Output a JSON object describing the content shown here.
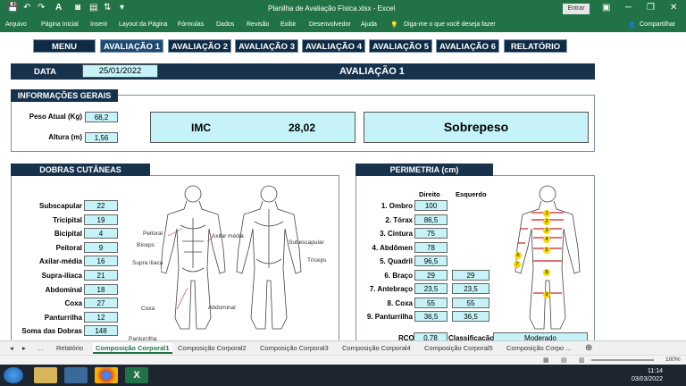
{
  "window": {
    "title": "Planilha de Avaliação Física.xlsx  -  Excel",
    "signin_label": "Entrar"
  },
  "ribbon": {
    "tabs": [
      "Arquivo",
      "Página Inicial",
      "Inserir",
      "Layout da Página",
      "Fórmulas",
      "Dados",
      "Revisão",
      "Exibir",
      "Desenvolvedor",
      "Ajuda"
    ],
    "tell_me": "Diga-me o que você deseja fazer",
    "share": "Compartilhar"
  },
  "nav": [
    "MENU",
    "AVALIAÇÃO 1",
    "AVALIAÇÃO 2",
    "AVALIAÇÃO 3",
    "AVALIAÇÃO 4",
    "AVALIAÇÃO 5",
    "AVALIAÇÃO 6",
    "RELATÓRIO"
  ],
  "header": {
    "date_label": "DATA",
    "date_value": "25/01/2022",
    "title": "AVALIAÇÃO 1"
  },
  "general": {
    "title": "INFORMAÇÕES GERAIS",
    "weight_label": "Peso Atual (Kg)",
    "weight_value": "68,2",
    "height_label": "Altura (m)",
    "height_value": "1,56",
    "imc_label": "IMC",
    "imc_value": "28,02",
    "classification": "Sobrepeso"
  },
  "skinfolds": {
    "title": "DOBRAS CUTÂNEAS",
    "rows": [
      {
        "label": "Subscapular",
        "value": "22"
      },
      {
        "label": "Tricipital",
        "value": "19"
      },
      {
        "label": "Bicipital",
        "value": "4"
      },
      {
        "label": "Peitoral",
        "value": "9"
      },
      {
        "label": "Axilar-média",
        "value": "16"
      },
      {
        "label": "Supra-ilíaca",
        "value": "21"
      },
      {
        "label": "Abdominal",
        "value": "18"
      },
      {
        "label": "Coxa",
        "value": "27"
      },
      {
        "label": "Panturrilha",
        "value": "12"
      },
      {
        "label": "Soma das Dobras",
        "value": "148"
      }
    ],
    "anatomy_labels": [
      "Peitoral",
      "Axilar média",
      "Bíceps",
      "Supra ilíaca",
      "Coxa",
      "Abdominal",
      "Panturrilha",
      "Subescapular",
      "Tríceps"
    ]
  },
  "perimeter": {
    "title": "PERIMETRIA (cm)",
    "col_right": "Direito",
    "col_left": "Esquerdo",
    "rows": [
      {
        "label": "1. Ombro",
        "right": "100",
        "left": ""
      },
      {
        "label": "2. Tórax",
        "right": "86,5",
        "left": ""
      },
      {
        "label": "3. Cintura",
        "right": "75",
        "left": ""
      },
      {
        "label": "4. Abdômen",
        "right": "78",
        "left": ""
      },
      {
        "label": "5. Quadril",
        "right": "96,5",
        "left": ""
      },
      {
        "label": "6. Braço",
        "right": "29",
        "left": "29"
      },
      {
        "label": "7. Antebraço",
        "right": "23,5",
        "left": "23,5"
      },
      {
        "label": "8. Coxa",
        "right": "55",
        "left": "55"
      },
      {
        "label": "9. Panturrilha",
        "right": "36,5",
        "left": "36,5"
      }
    ],
    "rcq_label": "RCQ",
    "rcq_value": "0,78",
    "class_label": "Classificação",
    "class_value": "Moderado",
    "marker_numbers": [
      "1",
      "2",
      "3",
      "4",
      "5",
      "6",
      "7",
      "8",
      "9"
    ]
  },
  "sheet_tabs": [
    "Relatório",
    "Composição Corporal1",
    "Composição Corporal2",
    "Composição Corporal3",
    "Composição Corporal4",
    "Composição Corporal5",
    "Composição Corpo ..."
  ],
  "active_tab": 1,
  "status": {
    "zoom": "100%"
  },
  "taskbar": {
    "time": "11:14",
    "date": "03/03/2022"
  },
  "colors": {
    "excel_green": "#217346",
    "navy": "#17324d",
    "cyan": "#c5f3f7"
  }
}
